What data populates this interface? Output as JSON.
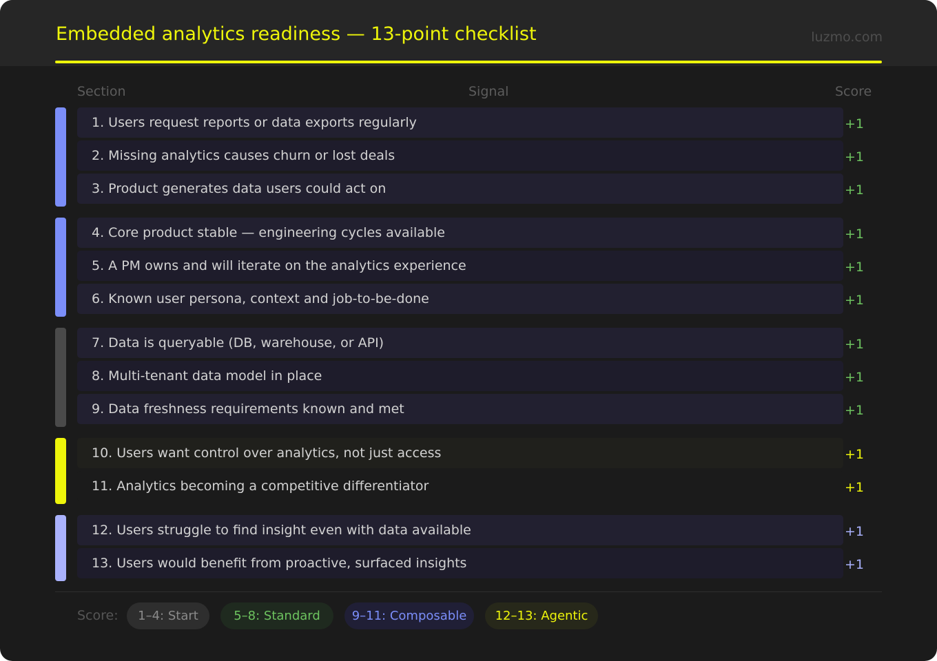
{
  "header": {
    "title": "Embedded analytics readiness — 13-point checklist",
    "brand": "luzmo.com"
  },
  "columns": {
    "section": "Section",
    "signal": "Signal",
    "score": "Score"
  },
  "colors": {
    "accent": "#eef50a",
    "group_blue": "#7b8ef9",
    "group_gray": "#4a4a4a",
    "group_yellow": "#eef50a",
    "group_lavender": "#aab2fd",
    "score_green": "#6dc35f",
    "score_yellow": "#eef50a",
    "score_lavender": "#aab2fd"
  },
  "rows": [
    {
      "label": "1. Users request reports or data exports regularly",
      "score": "+1"
    },
    {
      "label": "2. Missing analytics causes churn or lost deals",
      "score": "+1"
    },
    {
      "label": "3. Product generates data users could act on",
      "score": "+1"
    },
    {
      "label": "4. Core product stable — engineering cycles available",
      "score": "+1"
    },
    {
      "label": "5. A PM owns and will iterate on the analytics experience",
      "score": "+1"
    },
    {
      "label": "6. Known user persona, context and job-to-be-done",
      "score": "+1"
    },
    {
      "label": "7. Data is queryable (DB, warehouse, or API)",
      "score": "+1"
    },
    {
      "label": "8. Multi-tenant data model in place",
      "score": "+1"
    },
    {
      "label": "9. Data freshness requirements known and met",
      "score": "+1"
    },
    {
      "label": "10. Users want control over analytics, not just access",
      "score": "+1"
    },
    {
      "label": "11. Analytics becoming a competitive differentiator",
      "score": "+1"
    },
    {
      "label": "12. Users struggle to find insight even with data available",
      "score": "+1"
    },
    {
      "label": "13. Users would benefit from proactive, surfaced insights",
      "score": "+1"
    }
  ],
  "legend": {
    "label": "Score:",
    "tiers": [
      {
        "label": "1–4: Start"
      },
      {
        "label": "5–8: Standard"
      },
      {
        "label": "9–11: Composable"
      },
      {
        "label": "12–13: Agentic"
      }
    ]
  }
}
